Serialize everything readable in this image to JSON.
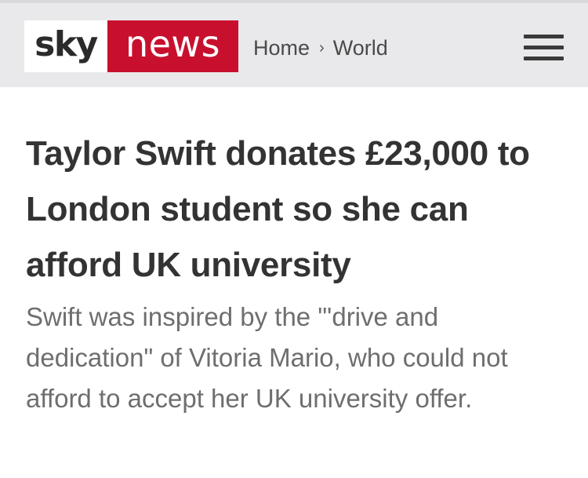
{
  "header": {
    "logo": {
      "sky": "sky",
      "news": "news",
      "brand_color": "#c8102e"
    },
    "breadcrumb": {
      "home": "Home",
      "separator": "›",
      "section": "World"
    },
    "menu_icon": "hamburger-menu-icon"
  },
  "article": {
    "headline": "Taylor Swift donates £23,000 to London student so she can afford UK university",
    "standfirst": "Swift was inspired by the \"'drive and dedication\" of Vitoria Mario, who could not afford to accept her UK university offer."
  }
}
